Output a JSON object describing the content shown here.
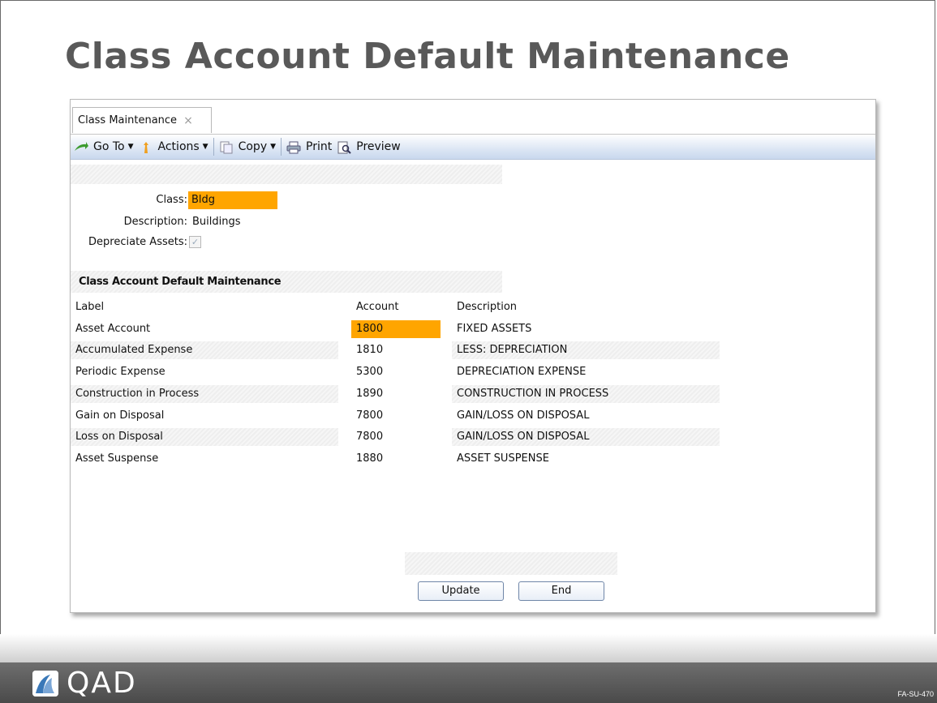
{
  "slide": {
    "title": "Class Account Default Maintenance",
    "code": "FA-SU-470",
    "logo_text": "QAD"
  },
  "window": {
    "tab_label": "Class Maintenance",
    "tab_close": "×",
    "toolbar": [
      {
        "label": "Go To",
        "icon": "goto-icon",
        "dropdown": true
      },
      {
        "label": "Actions",
        "icon": "actions-icon",
        "dropdown": true
      },
      {
        "label": "Copy",
        "icon": "copy-icon",
        "dropdown": true
      },
      {
        "label": "Print",
        "icon": "print-icon",
        "dropdown": false
      },
      {
        "label": "Preview",
        "icon": "preview-icon",
        "dropdown": false
      }
    ],
    "form": {
      "class_label": "Class:",
      "class_value": "Bldg",
      "description_label": "Description:",
      "description_value": "Buildings",
      "depreciate_label": "Depreciate Assets:",
      "depreciate_checked": true
    },
    "section_title": "Class Account Default Maintenance",
    "grid": {
      "headers": {
        "label": "Label",
        "account": "Account",
        "description": "Description"
      },
      "rows": [
        {
          "label": "Asset Account",
          "account": "1800",
          "description": "FIXED ASSETS"
        },
        {
          "label": "Accumulated Expense",
          "account": "1810",
          "description": "LESS:  DEPRECIATION"
        },
        {
          "label": "Periodic Expense",
          "account": "5300",
          "description": "DEPRECIATION EXPENSE"
        },
        {
          "label": "Construction in Process",
          "account": "1890",
          "description": "CONSTRUCTION IN PROCESS"
        },
        {
          "label": "Gain on Disposal",
          "account": "7800",
          "description": "GAIN/LOSS ON DISPOSAL"
        },
        {
          "label": "Loss on Disposal",
          "account": "7800",
          "description": "GAIN/LOSS ON DISPOSAL"
        },
        {
          "label": "Asset Suspense",
          "account": "1880",
          "description": "ASSET SUSPENSE"
        }
      ]
    },
    "buttons": {
      "update": "Update",
      "end": "End"
    }
  },
  "colors": {
    "highlight": "#ffa500",
    "toolbar": "#dce6f4",
    "footer": "#5a5a5a"
  }
}
